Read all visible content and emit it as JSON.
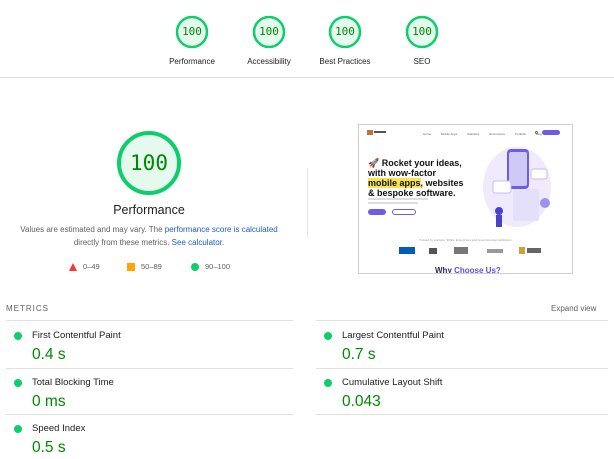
{
  "summary": {
    "gauges": [
      {
        "label": "Performance",
        "score": "100"
      },
      {
        "label": "Accessibility",
        "score": "100"
      },
      {
        "label": "Best Practices",
        "score": "100"
      },
      {
        "label": "SEO",
        "score": "100"
      }
    ]
  },
  "performance": {
    "score": "100",
    "title": "Performance",
    "desc_prefix": "Values are estimated and may vary. The ",
    "desc_link1": "performance score is calculated",
    "desc_middle": " directly from these metrics. ",
    "desc_link2": "See calculator.",
    "legend": [
      {
        "range": "0–49",
        "shape": "triangle",
        "color": "#ff3333"
      },
      {
        "range": "50–89",
        "shape": "square",
        "color": "#ffa400"
      },
      {
        "range": "90–100",
        "shape": "circle",
        "color": "#0cce6b"
      }
    ]
  },
  "screenshot": {
    "nav_links": [
      "Home",
      "Mobile Apps",
      "Websites",
      "Ecommerce",
      "Portfolio",
      "Blog"
    ],
    "headline_1": "🚀 Rocket your ideas,",
    "headline_2": "with wow-factor",
    "headline_hl": "mobile apps",
    "headline_3": ", websites",
    "headline_4": "& bespoke software.",
    "trust_text": "Trusted by startups, SMEs, Enterprises and Governmental institutions",
    "why_prefix": "Why ",
    "why_link": "Choose Us?"
  },
  "metrics": {
    "title": "METRICS",
    "expand": "Expand view",
    "items": [
      {
        "label": "First Contentful Paint",
        "value": "0.4 s"
      },
      {
        "label": "Largest Contentful Paint",
        "value": "0.7 s"
      },
      {
        "label": "Total Blocking Time",
        "value": "0 ms"
      },
      {
        "label": "Cumulative Layout Shift",
        "value": "0.043"
      },
      {
        "label": "Speed Index",
        "value": "0.5 s"
      }
    ]
  },
  "colors": {
    "pass": "#0cce6b",
    "pass_text": "#008800",
    "average": "#ffa400",
    "fail": "#ff3333",
    "link": "#1a5fce"
  }
}
